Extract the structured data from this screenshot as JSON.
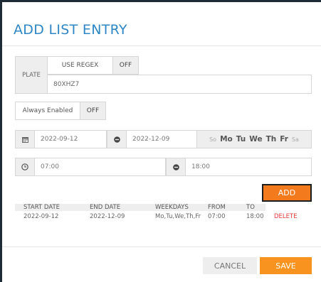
{
  "dialog": {
    "title": "ADD LIST ENTRY"
  },
  "plate": {
    "label": "PLATE",
    "regex_label": "USE REGEX",
    "regex_toggle": "OFF",
    "value": "80XHZ7"
  },
  "always_enabled": {
    "label": "Always Enabled",
    "toggle": "OFF"
  },
  "dates": {
    "start": "2022-09-12",
    "end": "2022-12-09",
    "weekdays": [
      {
        "label": "So",
        "selected": false
      },
      {
        "label": "Mo",
        "selected": true
      },
      {
        "label": "Tu",
        "selected": true
      },
      {
        "label": "We",
        "selected": true
      },
      {
        "label": "Th",
        "selected": true
      },
      {
        "label": "Fr",
        "selected": true
      },
      {
        "label": "Sa",
        "selected": false
      }
    ]
  },
  "times": {
    "from": "07:00",
    "to": "18:00"
  },
  "icons": {
    "calendar": "calendar-icon",
    "circle_minus": "minus-circle-icon",
    "clock": "clock-icon"
  },
  "add_label": "ADD",
  "table": {
    "headers": [
      "START DATE",
      "END DATE",
      "WEEKDAYS",
      "FROM",
      "TO"
    ],
    "rows": [
      [
        "2022-09-12",
        "2022-12-09",
        "Mo,Tu,We,Th,Fr",
        "07:00",
        "18:00",
        "DELETE"
      ]
    ]
  },
  "footer": {
    "cancel": "CANCEL",
    "save": "SAVE"
  },
  "colors": {
    "accent_blue": "#2f86c5",
    "accent_orange": "#f7931e",
    "delete_red": "#e33b3b"
  }
}
